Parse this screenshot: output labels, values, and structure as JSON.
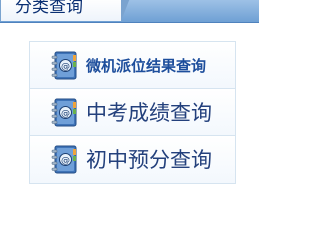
{
  "header": {
    "tab_label": "分类查询"
  },
  "menu": {
    "items": [
      {
        "label": "微机派位结果查询",
        "icon": "address-book-icon"
      },
      {
        "label": "中考成绩查询",
        "icon": "address-book-icon"
      },
      {
        "label": "初中预分查询",
        "icon": "address-book-icon"
      }
    ]
  },
  "colors": {
    "header_blue": "#6fa0d4",
    "tab_text": "#0a2f73",
    "item_text": "#23407c",
    "border": "#d6e4f0"
  }
}
